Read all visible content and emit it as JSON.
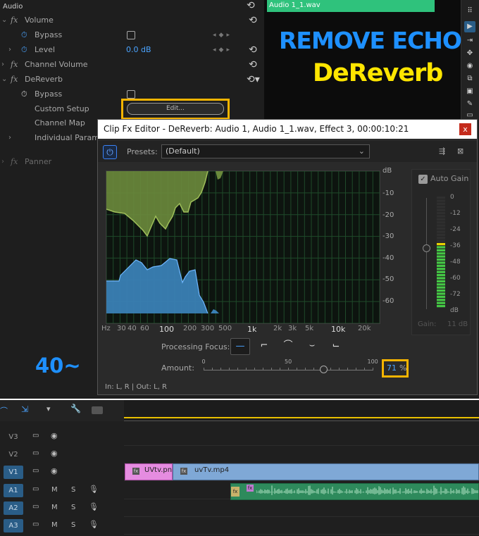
{
  "effects": {
    "section_title": "Audio",
    "volume_label": "Volume",
    "bypass_label": "Bypass",
    "level_label": "Level",
    "level_value": "0.0 dB",
    "channel_volume_label": "Channel Volume",
    "dereverb_label": "DeReverb",
    "bypass2_label": "Bypass",
    "custom_setup_label": "Custom Setup",
    "edit_button": "Edit...",
    "channel_map_label": "Channel Map",
    "individual_params_label": "Individual Parame",
    "panner_label": "Panner",
    "fx_glyph": "fx"
  },
  "monitor": {
    "clip_label": "Audio 1_1.wav"
  },
  "overlay": {
    "remove_echo": "REMOVE ECHO",
    "dereverb": "DeReverb",
    "amount_hint": "40~"
  },
  "dialog": {
    "title": "Clip Fx Editor - DeReverb: Audio 1, Audio 1_1.wav, Effect 3, 00:00:10:21",
    "close_glyph": "x",
    "presets_label": "Presets:",
    "preset_value": "(Default)",
    "db_unit": "dB",
    "db_ticks": [
      "-10",
      "-20",
      "-30",
      "-40",
      "-50",
      "-60"
    ],
    "freq_ticks": [
      "Hz",
      "30",
      "40",
      "60",
      "100",
      "200",
      "300",
      "500",
      "1k",
      "2k",
      "3k",
      "5k",
      "10k",
      "20k"
    ],
    "auto_gain_label": "Auto Gain",
    "auto_gain_checked": true,
    "gain_meter_ticks": [
      "0",
      "-12",
      "-24",
      "-36",
      "-48",
      "-60",
      "-72",
      "dB"
    ],
    "gain_label": "Gain:",
    "gain_value": "11 dB",
    "processing_focus_label": "Processing Focus:",
    "amount_label": "Amount:",
    "amount_scale": [
      "0",
      "50",
      "100"
    ],
    "amount_value": "71",
    "amount_percent": 71,
    "percent_sign": "%",
    "io_label": "In: L, R | Out: L, R"
  },
  "timeline": {
    "video_tracks": [
      "V3",
      "V2",
      "V1"
    ],
    "audio_tracks": [
      "A1",
      "A2",
      "A3"
    ],
    "m_label": "M",
    "s_label": "S",
    "clip_v1_a": "UVtv.pn",
    "clip_v1_b": "uvTv.mp4",
    "fx_badge": "fx"
  },
  "colors": {
    "accent_blue": "#1e90ff",
    "highlight_yellow": "#f5b400",
    "title_yellow": "#ffe600",
    "audio_clip_green": "#2fc27c",
    "video_clip_blue": "#7fa8d6",
    "video_clip_pink": "#e07fd6"
  }
}
